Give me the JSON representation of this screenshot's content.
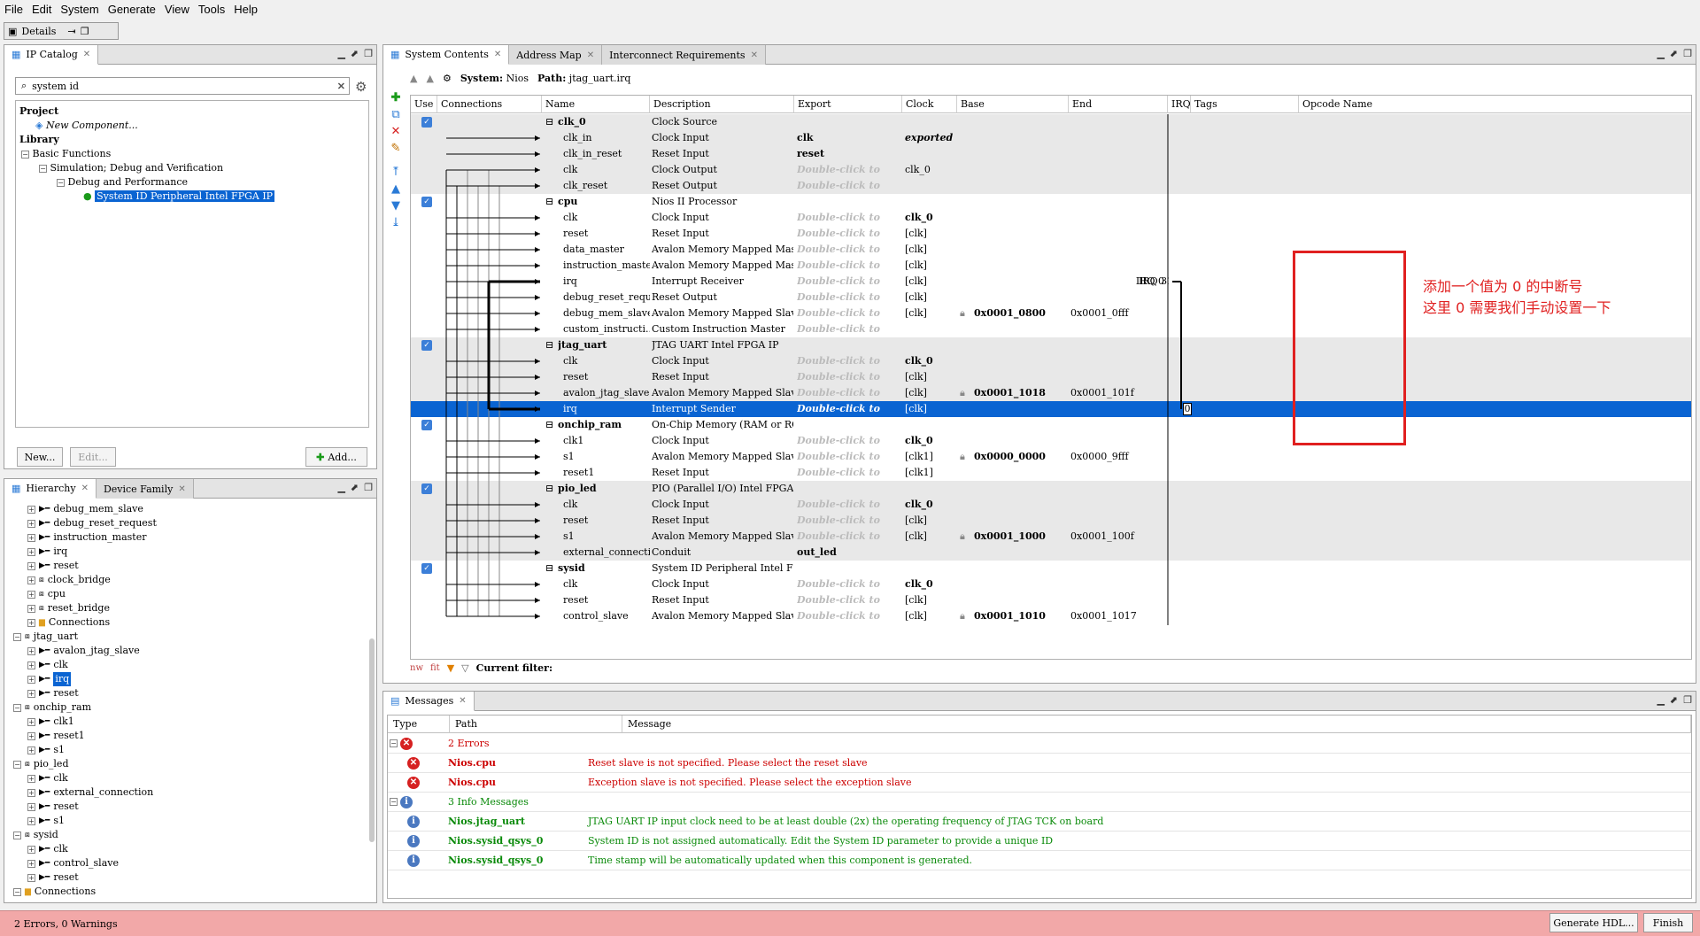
{
  "menu": [
    "File",
    "Edit",
    "System",
    "Generate",
    "View",
    "Tools",
    "Help"
  ],
  "details_tab": "Details",
  "ip_catalog": {
    "tab": "IP Catalog",
    "search_value": "system id",
    "tree": {
      "project": "Project",
      "new_component": "New Component...",
      "library": "Library",
      "basic_functions": "Basic Functions",
      "simulation": "Simulation; Debug and Verification",
      "debug_perf": "Debug and Performance",
      "selected_ip": "System ID Peripheral Intel FPGA IP"
    },
    "new_btn": "New...",
    "edit_btn": "Edit...",
    "add_btn": "Add..."
  },
  "hierarchy": {
    "tabs": [
      "Hierarchy",
      "Device Family"
    ],
    "rows": [
      {
        "indent": 1,
        "label": "debug_mem_slave",
        "icon": "port"
      },
      {
        "indent": 1,
        "label": "debug_reset_request",
        "icon": "port"
      },
      {
        "indent": 1,
        "label": "instruction_master",
        "icon": "port"
      },
      {
        "indent": 1,
        "label": "irq",
        "icon": "port"
      },
      {
        "indent": 1,
        "label": "reset",
        "icon": "port"
      },
      {
        "indent": 1,
        "label": "clock_bridge",
        "icon": "module"
      },
      {
        "indent": 1,
        "label": "cpu",
        "icon": "module"
      },
      {
        "indent": 1,
        "label": "reset_bridge",
        "icon": "module"
      },
      {
        "indent": 1,
        "label": "Connections",
        "icon": "folder"
      },
      {
        "indent": 0,
        "label": "jtag_uart",
        "icon": "module"
      },
      {
        "indent": 1,
        "label": "avalon_jtag_slave",
        "icon": "port"
      },
      {
        "indent": 1,
        "label": "clk",
        "icon": "port"
      },
      {
        "indent": 1,
        "label": "irq",
        "icon": "port",
        "selected": true
      },
      {
        "indent": 1,
        "label": "reset",
        "icon": "port"
      },
      {
        "indent": 0,
        "label": "onchip_ram",
        "icon": "module"
      },
      {
        "indent": 1,
        "label": "clk1",
        "icon": "port"
      },
      {
        "indent": 1,
        "label": "reset1",
        "icon": "port"
      },
      {
        "indent": 1,
        "label": "s1",
        "icon": "port"
      },
      {
        "indent": 0,
        "label": "pio_led",
        "icon": "module"
      },
      {
        "indent": 1,
        "label": "clk",
        "icon": "port"
      },
      {
        "indent": 1,
        "label": "external_connection",
        "icon": "port"
      },
      {
        "indent": 1,
        "label": "reset",
        "icon": "port"
      },
      {
        "indent": 1,
        "label": "s1",
        "icon": "port"
      },
      {
        "indent": 0,
        "label": "sysid",
        "icon": "module"
      },
      {
        "indent": 1,
        "label": "clk",
        "icon": "port"
      },
      {
        "indent": 1,
        "label": "control_slave",
        "icon": "port"
      },
      {
        "indent": 1,
        "label": "reset",
        "icon": "port"
      },
      {
        "indent": 0,
        "label": "Connections",
        "icon": "folder"
      }
    ]
  },
  "system_contents": {
    "tabs": [
      "System Contents",
      "Address Map",
      "Interconnect Requirements"
    ],
    "system_label": "System:",
    "system_name": "Nios",
    "path_label": "Path:",
    "path_value": "jtag_uart.irq",
    "columns": [
      "Use",
      "Connections",
      "Name",
      "Description",
      "Export",
      "Clock",
      "Base",
      "End",
      "IRQ",
      "Tags",
      "Opcode Name"
    ],
    "rows": [
      {
        "module": true,
        "check": true,
        "name": "clk_0",
        "desc": "Clock Source",
        "export": "",
        "clock": "",
        "base": "",
        "end": "",
        "shade": true
      },
      {
        "name": "clk_in",
        "desc": "Clock Input",
        "export": "clk",
        "export_bold": true,
        "clock": "exported",
        "clock_style": "bolditalic",
        "shade": true
      },
      {
        "name": "clk_in_reset",
        "desc": "Reset Input",
        "export": "reset",
        "export_bold": true,
        "clock": "",
        "shade": true
      },
      {
        "name": "clk",
        "desc": "Clock Output",
        "export": "Double-click to",
        "export_dbl": true,
        "clock": "clk_0",
        "shade": true
      },
      {
        "name": "clk_reset",
        "desc": "Reset Output",
        "export": "Double-click to",
        "export_dbl": true,
        "clock": "",
        "shade": true
      },
      {
        "module": true,
        "check": true,
        "name": "cpu",
        "desc": "Nios II Processor",
        "export": "",
        "clock": ""
      },
      {
        "name": "clk",
        "desc": "Clock Input",
        "export": "Double-click to",
        "export_dbl": true,
        "clock": "clk_0",
        "clock_bold": true
      },
      {
        "name": "reset",
        "desc": "Reset Input",
        "export": "Double-click to",
        "export_dbl": true,
        "clock": "[clk]"
      },
      {
        "name": "data_master",
        "desc": "Avalon Memory Mapped Master",
        "export": "Double-click to",
        "export_dbl": true,
        "clock": "[clk]"
      },
      {
        "name": "instruction_master",
        "desc": "Avalon Memory Mapped Master",
        "export": "Double-click to",
        "export_dbl": true,
        "clock": "[clk]"
      },
      {
        "name": "irq",
        "desc": "Interrupt Receiver",
        "export": "Double-click to",
        "export_dbl": true,
        "clock": "[clk]",
        "end": "IRQ 0",
        "irq": "IRQ 31"
      },
      {
        "name": "debug_reset_request",
        "desc": "Reset Output",
        "export": "Double-click to",
        "export_dbl": true,
        "clock": "[clk]"
      },
      {
        "name": "debug_mem_slave",
        "desc": "Avalon Memory Mapped Slave",
        "export": "Double-click to",
        "export_dbl": true,
        "clock": "[clk]",
        "base": "0x0001_0800",
        "end": "0x0001_0fff"
      },
      {
        "name": "custom_instructi...",
        "desc": "Custom Instruction Master",
        "export": "Double-click to",
        "export_dbl": true,
        "clock": ""
      },
      {
        "module": true,
        "check": true,
        "name": "jtag_uart",
        "desc": "JTAG UART Intel FPGA IP",
        "export": "",
        "clock": "",
        "shade": true
      },
      {
        "name": "clk",
        "desc": "Clock Input",
        "export": "Double-click to",
        "export_dbl": true,
        "clock": "clk_0",
        "clock_bold": true,
        "shade": true
      },
      {
        "name": "reset",
        "desc": "Reset Input",
        "export": "Double-click to",
        "export_dbl": true,
        "clock": "[clk]",
        "shade": true
      },
      {
        "name": "avalon_jtag_slave",
        "desc": "Avalon Memory Mapped Slave",
        "export": "Double-click to",
        "export_dbl": true,
        "clock": "[clk]",
        "base": "0x0001_1018",
        "end": "0x0001_101f",
        "shade": true
      },
      {
        "name": "irq",
        "desc": "Interrupt Sender",
        "export": "Double-click to",
        "export_dbl": true,
        "clock": "[clk]",
        "irq_value": "0",
        "selected": true
      },
      {
        "module": true,
        "check": true,
        "name": "onchip_ram",
        "desc": "On-Chip Memory (RAM or ROM) I...",
        "export": "",
        "clock": ""
      },
      {
        "name": "clk1",
        "desc": "Clock Input",
        "export": "Double-click to",
        "export_dbl": true,
        "clock": "clk_0",
        "clock_bold": true
      },
      {
        "name": "s1",
        "desc": "Avalon Memory Mapped Slave",
        "export": "Double-click to",
        "export_dbl": true,
        "clock": "[clk1]",
        "base": "0x0000_0000",
        "end": "0x0000_9fff"
      },
      {
        "name": "reset1",
        "desc": "Reset Input",
        "export": "Double-click to",
        "export_dbl": true,
        "clock": "[clk1]"
      },
      {
        "module": true,
        "check": true,
        "name": "pio_led",
        "desc": "PIO (Parallel I/O) Intel FPGA IP",
        "export": "",
        "clock": "",
        "shade": true
      },
      {
        "name": "clk",
        "desc": "Clock Input",
        "export": "Double-click to",
        "export_dbl": true,
        "clock": "clk_0",
        "clock_bold": true,
        "shade": true
      },
      {
        "name": "reset",
        "desc": "Reset Input",
        "export": "Double-click to",
        "export_dbl": true,
        "clock": "[clk]",
        "shade": true
      },
      {
        "name": "s1",
        "desc": "Avalon Memory Mapped Slave",
        "export": "Double-click to",
        "export_dbl": true,
        "clock": "[clk]",
        "base": "0x0001_1000",
        "end": "0x0001_100f",
        "shade": true
      },
      {
        "name": "external_connection",
        "desc": "Conduit",
        "export": "out_led",
        "export_bold": true,
        "clock": "",
        "shade": true
      },
      {
        "module": true,
        "check": true,
        "name": "sysid",
        "desc": "System ID Peripheral Intel FP...",
        "export": "",
        "clock": ""
      },
      {
        "name": "clk",
        "desc": "Clock Input",
        "export": "Double-click to",
        "export_dbl": true,
        "clock": "clk_0",
        "clock_bold": true
      },
      {
        "name": "reset",
        "desc": "Reset Input",
        "export": "Double-click to",
        "export_dbl": true,
        "clock": "[clk]"
      },
      {
        "name": "control_slave",
        "desc": "Avalon Memory Mapped Slave",
        "export": "Double-click to",
        "export_dbl": true,
        "clock": "[clk]",
        "base": "0x0001_1010",
        "end": "0x0001_1017"
      }
    ],
    "filter_label": "Current filter:"
  },
  "messages": {
    "tab": "Messages",
    "columns": [
      "Type",
      "Path",
      "Message"
    ],
    "rows": [
      {
        "kind": "error-group",
        "path": "2 Errors",
        "message": ""
      },
      {
        "kind": "error",
        "path": "Nios.cpu",
        "message": "Reset slave is not specified. Please select the reset slave"
      },
      {
        "kind": "error",
        "path": "Nios.cpu",
        "message": "Exception slave is not specified. Please select the exception slave"
      },
      {
        "kind": "info-group",
        "path": "3 Info Messages",
        "message": ""
      },
      {
        "kind": "info",
        "path": "Nios.jtag_uart",
        "message": "JTAG UART IP input clock need to be at least double (2x) the operating frequency of JTAG TCK on board"
      },
      {
        "kind": "info",
        "path": "Nios.sysid_qsys_0",
        "message": "System ID is not assigned automatically. Edit the System ID parameter to provide a unique ID"
      },
      {
        "kind": "info",
        "path": "Nios.sysid_qsys_0",
        "message": "Time stamp will be automatically updated when this component is generated."
      }
    ]
  },
  "status": {
    "text": "2 Errors, 0 Warnings",
    "generate_btn": "Generate HDL...",
    "finish_btn": "Finish",
    "color": "#f2a8a8"
  },
  "annotation": {
    "line1": "添加一个值为 0 的中断号",
    "line2": "这里 0 需要我们手动设置一下",
    "color": "#e02020"
  }
}
